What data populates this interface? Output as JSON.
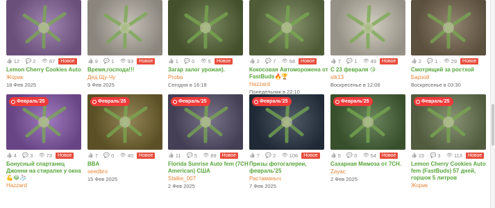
{
  "badge_label": "Февраль'25",
  "new_label": "Новое",
  "icons": {
    "likes": "thumbs-up-icon",
    "comments": "comment-icon",
    "views": "eye-icon"
  },
  "row1": [
    {
      "likes": "12",
      "comments": "2",
      "views": "87",
      "title": "Lemon Cherry Cookies Auto",
      "author": "Жорик",
      "date": "18 Фев 2025",
      "bg": "#8d6aa2",
      "badge": false
    },
    {
      "likes": "9",
      "comments": "1",
      "views": "93",
      "title": "Время,господа!!!",
      "author": "Дед Щу-Чу",
      "date": "9 Фев 2025",
      "bg": "#b9b2a8",
      "badge": false
    },
    {
      "likes": "1",
      "comments": "0",
      "views": "5",
      "title": "Загар залог урожая).",
      "author": "Proba",
      "date": "Сегодня в 16:18",
      "bg": "#5a6b3a",
      "badge": false
    },
    {
      "likes": "2",
      "comments": "7",
      "views": "58",
      "title": "Кокосовая Автоморожена от FastBuds🔥🏆",
      "author": "Hazzard",
      "date": "Понедельник в 22:10",
      "bg": "#6a7a4a",
      "badge": false
    },
    {
      "likes": "7",
      "comments": "1",
      "views": "49",
      "title": "С 23 февраля 😘",
      "author": "stk13",
      "date": "Воскресенье в 12:06",
      "bg": "#c9c3b4",
      "badge": false
    },
    {
      "likes": "2",
      "comments": "1",
      "views": "29",
      "title": "Смотрящий за ростхой",
      "author": "Барзой",
      "date": "Воскресенье в 03:30",
      "bg": "#7a6a52",
      "badge": false
    }
  ],
  "row2": [
    {
      "likes": "4",
      "comments": "3",
      "views": "73",
      "title": "Бонусный спартанец Джонни на стиралке у окна 💪😂🧦",
      "author": "Hazzard",
      "date": "",
      "bg": "#8a5cb0",
      "badge": true
    },
    {
      "likes": "7",
      "comments": "0",
      "views": "40",
      "title": "BBA",
      "author": "seedbro",
      "date": "15 Фев 2025",
      "bg": "#7a6a32",
      "badge": true
    },
    {
      "likes": "11",
      "comments": "5",
      "views": "89",
      "title": "Florida Sunrise Auto fem (7CH American) США",
      "author": "Stalke_007",
      "date": "2 Фев 2025",
      "bg": "#5b5470",
      "badge": true
    },
    {
      "likes": "7",
      "comments": "2",
      "views": "106",
      "title": "Призы фотогалереи, февраль'25",
      "author": "Растаманыч",
      "date": "7 Фев 2025",
      "bg": "#2b3848",
      "badge": true
    },
    {
      "likes": "5",
      "comments": "0",
      "views": "54",
      "title": "Сахарная Мимоза от 7CH.",
      "author": "Zayac",
      "date": "2 Фев 2025",
      "bg": "#4a6a3a",
      "badge": true
    },
    {
      "likes": "15",
      "comments": "3",
      "views": "113",
      "title": "Lemon Cherry Cookies Auto fem (FastBuds) 57 дней, горшок 5 литров",
      "author": "Жорик",
      "date": "",
      "bg": "#6d7a54",
      "badge": true
    }
  ]
}
